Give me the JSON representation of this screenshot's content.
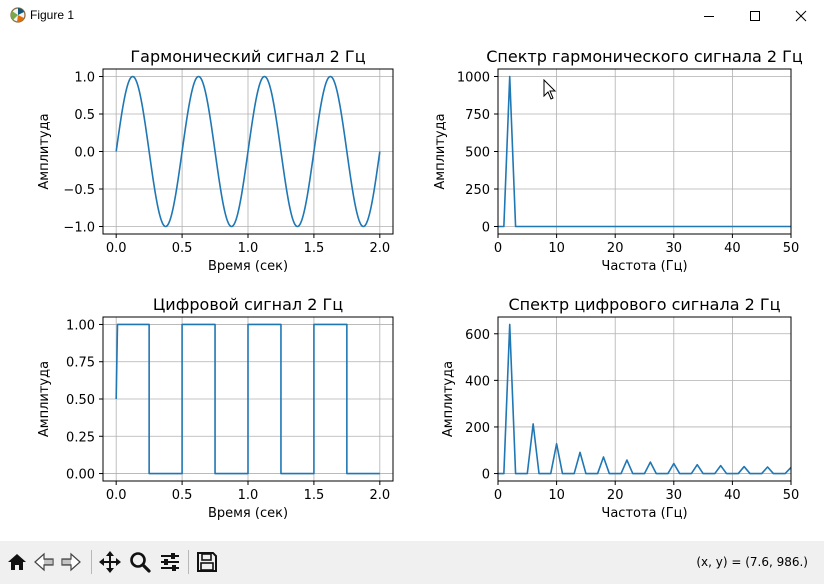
{
  "window": {
    "title": "Figure 1",
    "icon": "matplotlib-figure-icon",
    "controls": [
      "minimize-icon",
      "maximize-icon",
      "close-icon"
    ]
  },
  "toolbar": {
    "buttons": [
      "home-icon",
      "back-arrow-icon",
      "forward-arrow-icon",
      "pan-move-icon",
      "zoom-magnifier-icon",
      "subplots-config-icon",
      "save-floppy-icon"
    ],
    "coords": "(x, y) = (7.6, 986.)"
  },
  "colors": {
    "line": "#1f77b4",
    "grid": "#b0b0b0",
    "toolbar_bg": "#f0f0f0"
  },
  "chart_data": [
    {
      "type": "line",
      "title": "Гармонический сигнал 2 Гц",
      "xlabel": "Время (сек)",
      "ylabel": "Амплитуда",
      "xlim": [
        -0.1,
        2.1
      ],
      "ylim": [
        -1.1,
        1.1
      ],
      "xticks": [
        0.0,
        0.5,
        1.0,
        1.5,
        2.0
      ],
      "xtick_labels": [
        "0.0",
        "0.5",
        "1.0",
        "1.5",
        "2.0"
      ],
      "yticks": [
        -1.0,
        -0.5,
        0.0,
        0.5,
        1.0
      ],
      "ytick_labels": [
        "−1.0",
        "−0.5",
        "0.0",
        "0.5",
        "1.0"
      ],
      "grid": true,
      "series": [
        {
          "kind": "sine",
          "frequency_hz": 2,
          "amplitude": 1.0,
          "t_range": [
            0,
            2
          ]
        }
      ]
    },
    {
      "type": "line",
      "title": "Спектр гармонического сигнала 2 Гц",
      "xlabel": "Частота (Гц)",
      "ylabel": "Амплитуда",
      "xlim": [
        0,
        50
      ],
      "ylim": [
        -50,
        1050
      ],
      "xticks": [
        0,
        10,
        20,
        30,
        40,
        50
      ],
      "xtick_labels": [
        "0",
        "10",
        "20",
        "30",
        "40",
        "50"
      ],
      "yticks": [
        0,
        250,
        500,
        750,
        1000
      ],
      "ytick_labels": [
        "0",
        "250",
        "500",
        "750",
        "1000"
      ],
      "grid": true,
      "series": [
        {
          "x": [
            0,
            1,
            2,
            3,
            4,
            50
          ],
          "y": [
            0,
            0,
            1000,
            0,
            0,
            0
          ]
        }
      ]
    },
    {
      "type": "line",
      "title": "Цифровой сигнал 2 Гц",
      "xlabel": "Время (сек)",
      "ylabel": "Амплитуда",
      "xlim": [
        -0.1,
        2.1
      ],
      "ylim": [
        -0.05,
        1.05
      ],
      "xticks": [
        0.0,
        0.5,
        1.0,
        1.5,
        2.0
      ],
      "xtick_labels": [
        "0.0",
        "0.5",
        "1.0",
        "1.5",
        "2.0"
      ],
      "yticks": [
        0.0,
        0.25,
        0.5,
        0.75,
        1.0
      ],
      "ytick_labels": [
        "0.00",
        "0.25",
        "0.50",
        "0.75",
        "1.00"
      ],
      "grid": true,
      "series": [
        {
          "x": [
            0,
            0.01,
            0.25,
            0.25,
            0.5,
            0.5,
            0.75,
            0.75,
            1.0,
            1.0,
            1.25,
            1.25,
            1.5,
            1.5,
            1.75,
            1.75,
            2.0
          ],
          "y": [
            0.5,
            1,
            1,
            0,
            0,
            1,
            1,
            0,
            0,
            1,
            1,
            0,
            0,
            1,
            1,
            0,
            0
          ]
        }
      ]
    },
    {
      "type": "line",
      "title": "Спектр цифрового сигнала 2 Гц",
      "xlabel": "Частота (Гц)",
      "ylabel": "Амплитуда",
      "xlim": [
        0,
        50
      ],
      "ylim": [
        -32,
        672
      ],
      "xticks": [
        0,
        10,
        20,
        30,
        40,
        50
      ],
      "xtick_labels": [
        "0",
        "10",
        "20",
        "30",
        "40",
        "50"
      ],
      "yticks": [
        0,
        200,
        400,
        600
      ],
      "ytick_labels": [
        "0",
        "200",
        "400",
        "600"
      ],
      "grid": true,
      "series": [
        {
          "peaks_x": [
            2,
            6,
            10,
            14,
            18,
            22,
            26,
            30,
            34,
            38,
            42,
            46,
            50
          ],
          "peaks_y": [
            640,
            213,
            128,
            91,
            71,
            58,
            49,
            43,
            38,
            34,
            30,
            28,
            26
          ]
        }
      ]
    }
  ]
}
